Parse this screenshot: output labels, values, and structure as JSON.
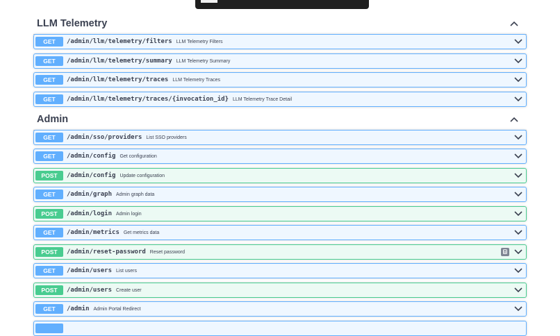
{
  "sections": [
    {
      "title": "LLM Telemetry",
      "operations": [
        {
          "method": "GET",
          "path": "/admin/llm/telemetry/filters",
          "summary": "LLM Telemetry Filters"
        },
        {
          "method": "GET",
          "path": "/admin/llm/telemetry/summary",
          "summary": "LLM Telemetry Summary"
        },
        {
          "method": "GET",
          "path": "/admin/llm/telemetry/traces",
          "summary": "LLM Telemetry Traces"
        },
        {
          "method": "GET",
          "path": "/admin/llm/telemetry/traces/{invocation_id}",
          "summary": "LLM Telemetry Trace Detail"
        }
      ]
    },
    {
      "title": "Admin",
      "operations": [
        {
          "method": "GET",
          "path": "/admin/sso/providers",
          "summary": "List SSO providers"
        },
        {
          "method": "GET",
          "path": "/admin/config",
          "summary": "Get configuration"
        },
        {
          "method": "POST",
          "path": "/admin/config",
          "summary": "Update configuration"
        },
        {
          "method": "GET",
          "path": "/admin/graph",
          "summary": "Admin graph data"
        },
        {
          "method": "POST",
          "path": "/admin/login",
          "summary": "Admin login"
        },
        {
          "method": "GET",
          "path": "/admin/metrics",
          "summary": "Get metrics data"
        },
        {
          "method": "POST",
          "path": "/admin/reset-password",
          "summary": "Reset password"
        },
        {
          "method": "GET",
          "path": "/admin/users",
          "summary": "List users"
        },
        {
          "method": "POST",
          "path": "/admin/users",
          "summary": "Create user"
        },
        {
          "method": "GET",
          "path": "/admin",
          "summary": "Admin Portal Redirect"
        }
      ]
    }
  ],
  "icons": {
    "expand": "chevron-down-icon",
    "collapse": "chevron-up-icon",
    "copy": "copy-icon"
  },
  "colors": {
    "get": "#61affe",
    "post": "#49cc90",
    "text": "#3b4151"
  }
}
